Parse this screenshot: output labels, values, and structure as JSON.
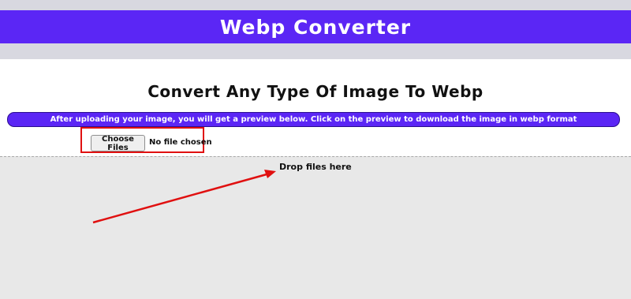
{
  "header": {
    "title": "Webp Converter"
  },
  "main": {
    "heading": "Convert Any Type Of Image To Webp",
    "info": "After uploading your image, you will get a preview below. Click on the preview to download the image in webp format"
  },
  "file_input": {
    "button_label": "Choose Files",
    "status": "No file chosen"
  },
  "dropzone": {
    "label": "Drop files here"
  },
  "colors": {
    "accent": "#5b26f5",
    "annotation": "#e01010",
    "dropzone_bg": "#e8e8e8"
  }
}
